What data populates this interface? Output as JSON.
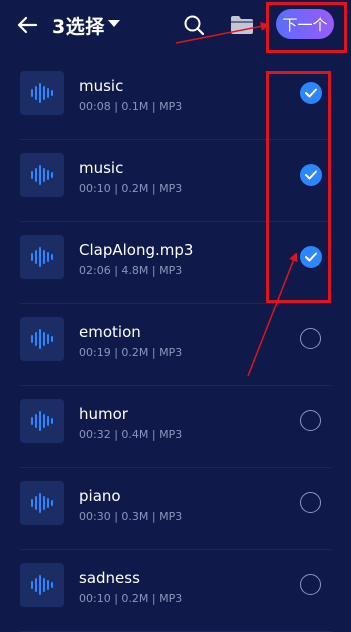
{
  "header": {
    "title": "3选择",
    "next_label": "下一个"
  },
  "files": [
    {
      "name": "music",
      "meta": "00:08 | 0.1M | MP3",
      "selected": true
    },
    {
      "name": "music",
      "meta": "00:10 | 0.2M | MP3",
      "selected": true
    },
    {
      "name": "ClapAlong.mp3",
      "meta": "02:06 | 4.8M | MP3",
      "selected": true
    },
    {
      "name": "emotion",
      "meta": "00:19 | 0.2M | MP3",
      "selected": false
    },
    {
      "name": "humor",
      "meta": "00:32 | 0.4M | MP3",
      "selected": false
    },
    {
      "name": "piano",
      "meta": "00:30 | 0.3M | MP3",
      "selected": false
    },
    {
      "name": "sadness",
      "meta": "00:10 | 0.2M | MP3",
      "selected": false
    }
  ],
  "colors": {
    "background": "#0f1a4a",
    "check": "#2b86ff",
    "annotation": "#e0141f"
  },
  "icons": [
    "back-arrow-icon",
    "dropdown-caret-icon",
    "search-icon",
    "folder-icon",
    "audio-waveform-icon",
    "checkmark-icon"
  ]
}
